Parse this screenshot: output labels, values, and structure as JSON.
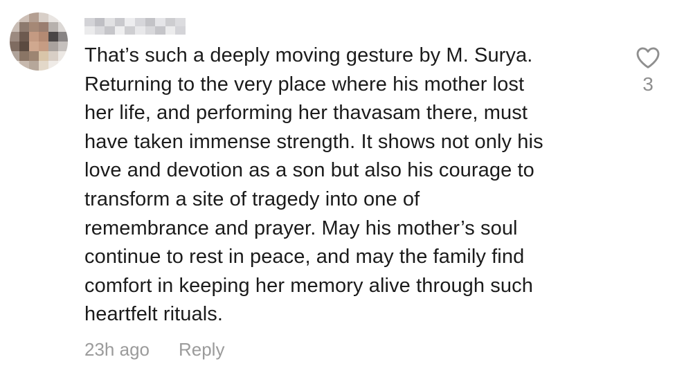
{
  "comment": {
    "avatar_icon": "blurred-avatar",
    "username_icon": "blurred-username",
    "text": "That’s such a deeply moving gesture by M. Surya.\nReturning to the very place where his mother lost\nher life, and performing her thavasam there, must\nhave taken immense strength. It shows not only his\nlove and devotion as a son but also his courage to\ntransform a site of tragedy into one of\nremembrance and prayer. May his mother’s soul\ncontinue to rest in peace, and may the family find\ncomfort in keeping her memory alive through such\nheartfelt rituals.",
    "timestamp": "23h ago",
    "reply_label": "Reply",
    "like_icon": "heart-outline-icon",
    "like_count": "3"
  },
  "colors": {
    "text": "#1b1b1b",
    "meta": "#9b9b9b",
    "like_icon": "#8f8f8f"
  }
}
